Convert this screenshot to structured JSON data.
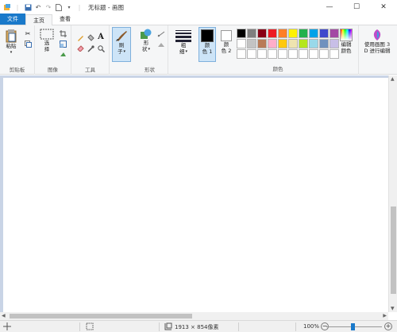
{
  "title": "无标题 - 画图",
  "tabs": [
    "文件",
    "主页",
    "查看"
  ],
  "clipboard": {
    "paste": "粘贴",
    "label": "剪贴板"
  },
  "image": {
    "select_1": "选",
    "select_2": "择",
    "label": "图像"
  },
  "tools": {
    "label": "工具"
  },
  "brush": {
    "line1": "刷",
    "line2": "子"
  },
  "shapes": {
    "line1": "形",
    "line2": "状",
    "label": "形状"
  },
  "size": {
    "line1": "粗",
    "line2": "细"
  },
  "color1": {
    "line1": "颜",
    "line2": "色 1"
  },
  "color2": {
    "line1": "颜",
    "line2": "色 2"
  },
  "colors_label": "颜色",
  "edit_colors": {
    "line1": "编辑",
    "line2": "颜色"
  },
  "paint3d": {
    "line1": "使用画图 3",
    "line2": "D 进行编辑"
  },
  "palette_row1": [
    "#000000",
    "#7f7f7f",
    "#880015",
    "#ed1c24",
    "#ff7f27",
    "#fff200",
    "#22b14c",
    "#00a2e8",
    "#3f48cc",
    "#a349a4"
  ],
  "palette_row2": [
    "#ffffff",
    "#c3c3c3",
    "#b97a57",
    "#ffaec9",
    "#ffc90e",
    "#efe4b0",
    "#b5e61d",
    "#99d9ea",
    "#7092be",
    "#c8bfe7"
  ],
  "palette_blank_count": 10,
  "status": {
    "dimensions": "1913 × 854像素",
    "zoom": "100%"
  }
}
